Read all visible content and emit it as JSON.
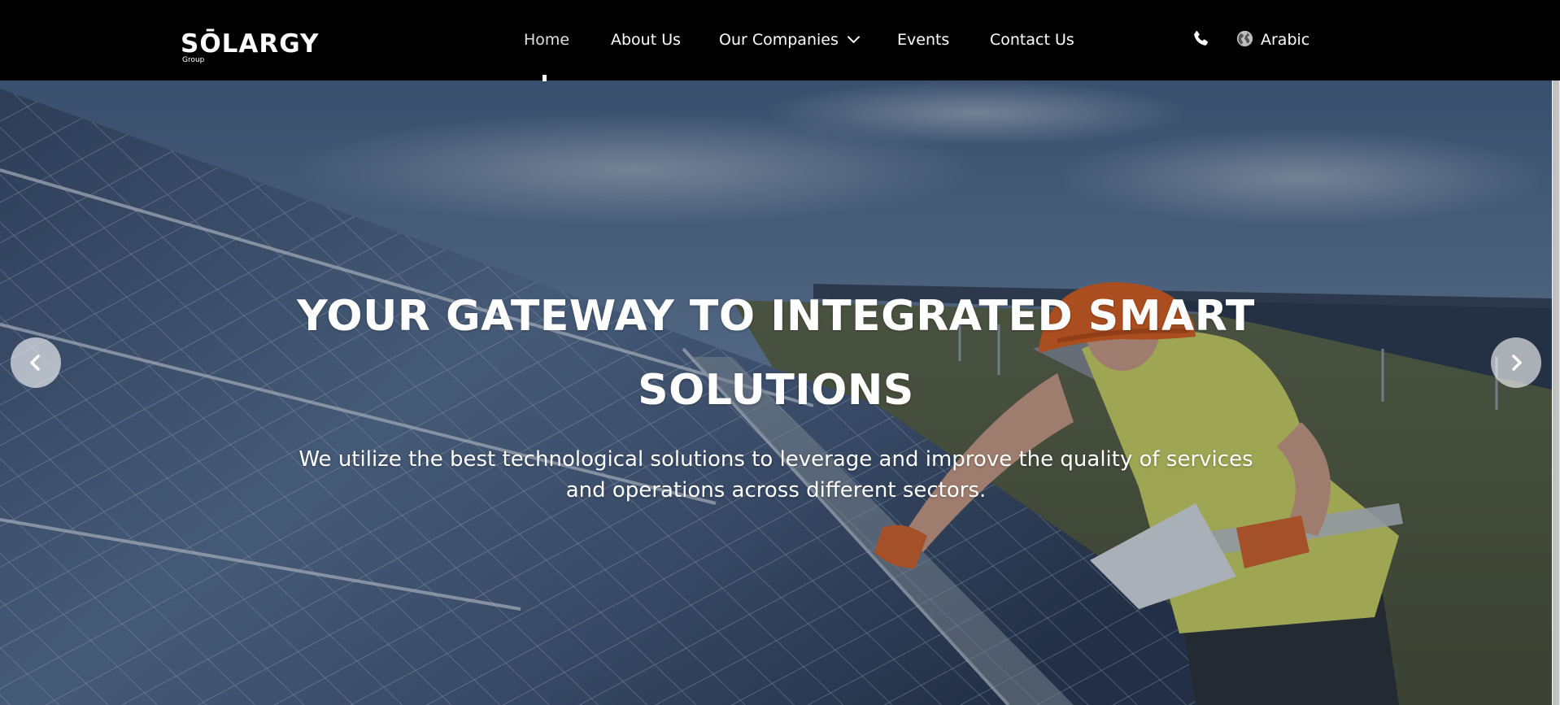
{
  "brand": {
    "name": "SŌLARGY",
    "sub": "Group"
  },
  "nav": {
    "home": "Home",
    "about": "About Us",
    "companies": "Our Companies",
    "events": "Events",
    "contact": "Contact Us"
  },
  "header_tools": {
    "language": "Arabic",
    "icons": [
      "phone-icon",
      "globe-icon"
    ]
  },
  "hero": {
    "title": "YOUR GATEWAY TO INTEGRATED SMART SOLUTIONS",
    "subtitle": "We utilize the best technological solutions to leverage and improve the quality of services and operations across different sectors.",
    "controls": [
      "chevron-left-icon",
      "chevron-right-icon"
    ]
  },
  "colors": {
    "header_bg": "#000000",
    "text": "#ffffff",
    "helmet": "#e8651e",
    "vest": "#d9e06a"
  }
}
